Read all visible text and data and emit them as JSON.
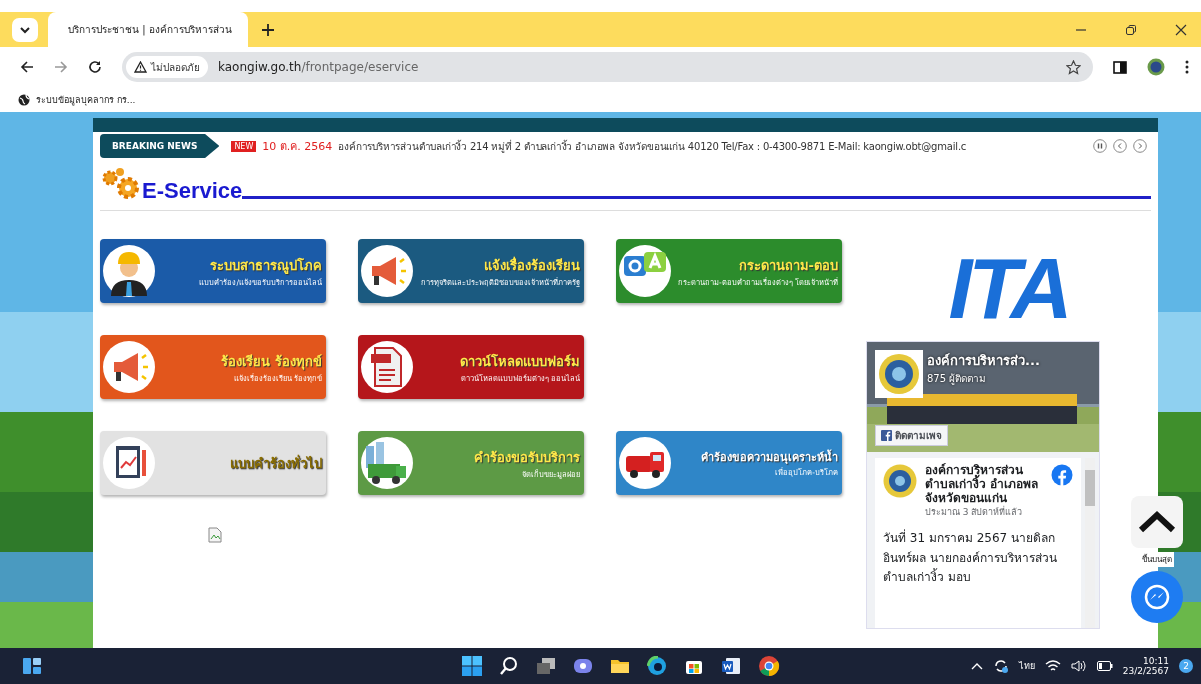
{
  "browser": {
    "tab": {
      "title": "บริการประชาชน | องค์การบริหารส่วน",
      "selected": true
    },
    "address": {
      "security": "ไม่ปลอดภัย",
      "domain": "kaongiw.go.th",
      "path": "/frontpage/eservice"
    },
    "bookmarks": [
      "ระบบข้อมูลบุคลากร กร..."
    ]
  },
  "news": {
    "label": "BREAKING NEWS",
    "badge": "NEW",
    "date": "10 ต.ค. 2564",
    "text": "องค์การบริหารส่วนตำบลเก่างิ้ว 214 หมู่ที่ 2 ตำบลเก่างิ้ว อำเภอพล จังหวัดขอนแก่น 40120 Tel/Fax : 0-4300-9871 E-Mail: kaongiw.obt@gmail.c"
  },
  "heading": "E-Service",
  "services": [
    {
      "kind": "worker",
      "title": "ระบบสาธารณูปโภค",
      "subtitle": "แบบคำร้อง/แจ้งขอรับบริการออนไลน์",
      "color": "#1b5ba8"
    },
    {
      "kind": "megaphone",
      "title": "แจ้งเรื่องร้องเรียน",
      "subtitle": "การทุจริตและประพฤติมิชอบของเจ้าหน้าที่ภาครัฐ",
      "color": "#1b5a80"
    },
    {
      "kind": "qa",
      "title": "กระดานถาม-ตอบ",
      "subtitle": "กระดานถาม-ตอบคำถามเรื่องต่างๆ โดยเจ้าหน้าที่",
      "color": "#2c8c2c"
    },
    {
      "kind": "megaphone",
      "title": "ร้องเรียน ร้องทุกข์",
      "subtitle": "แจ้งเรื่องร้องเรียน ร้องทุกข์",
      "color": "#e2561c"
    },
    {
      "kind": "pdf",
      "title": "ดาวน์โหลดแบบฟอร์ม",
      "subtitle": "ดาวน์โหลดแบบฟอร์มต่างๆ ออนไลน์",
      "color": "#b5161b"
    },
    {
      "kind": "blank"
    },
    {
      "kind": "clipboard",
      "title": "แบบคำร้องทั่วไป",
      "color": "#e2e2e2"
    },
    {
      "kind": "garbage",
      "title": "คำร้องขอรับบริการ",
      "subtitle": "จัดเก็บขยะมูลฝอย",
      "color": "#5d9a45"
    },
    {
      "kind": "firetruck",
      "title": "คำร้องขอความอนุเคราะห์น้ำ",
      "subtitle": "เพื่ออุปโภค-บริโภค",
      "color": "#2f86c8"
    }
  ],
  "logo": "ITA",
  "facebook": {
    "page_name": "องค์การบริหารส่ว...",
    "followers": "875 ผู้ติดตาม",
    "follow_button": "ติดตามเพจ",
    "post": {
      "author": "องค์การบริหารส่วนตำบลเก่างิ้ว อำเภอพล จังหวัดขอนแก่น",
      "time": "ประมาณ 3 สัปดาห์ที่แล้ว",
      "text": "วันที่ 31 มกราคม 2567 นายดิลก อินทร์ผล นายกองค์การบริหารส่วนตำบลเก่างิ้ว มอบ"
    }
  },
  "back_to_top": "ขึ้นบนสุด",
  "taskbar": {
    "language": "ไทย",
    "time": "10:11",
    "date": "23/2/2567",
    "notifications": "2"
  }
}
